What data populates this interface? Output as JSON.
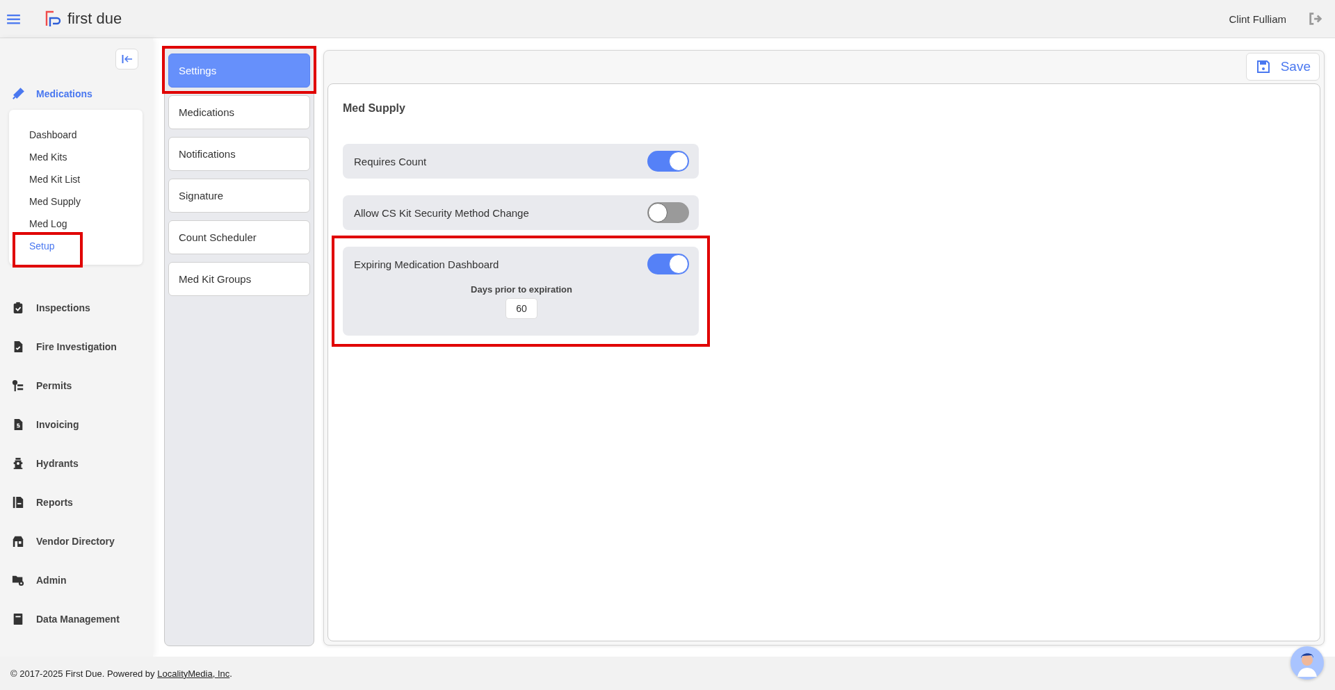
{
  "header": {
    "logo_text": "first due",
    "user_name": "Clint Fulliam"
  },
  "sidebar": {
    "section": {
      "label": "Medications",
      "selected": true
    },
    "submenu": [
      {
        "label": "Dashboard",
        "selected": false,
        "highlighted": false
      },
      {
        "label": "Med Kits",
        "selected": false,
        "highlighted": false
      },
      {
        "label": "Med Kit List",
        "selected": false,
        "highlighted": false
      },
      {
        "label": "Med Supply",
        "selected": false,
        "highlighted": false
      },
      {
        "label": "Med Log",
        "selected": false,
        "highlighted": false
      },
      {
        "label": "Setup",
        "selected": true,
        "highlighted": true
      }
    ],
    "items": [
      {
        "label": "Inspections"
      },
      {
        "label": "Fire Investigation"
      },
      {
        "label": "Permits"
      },
      {
        "label": "Invoicing"
      },
      {
        "label": "Hydrants"
      },
      {
        "label": "Reports"
      },
      {
        "label": "Vendor Directory"
      },
      {
        "label": "Admin"
      },
      {
        "label": "Data Management"
      }
    ]
  },
  "settings_nav": [
    {
      "label": "Settings",
      "selected": true,
      "highlighted": true
    },
    {
      "label": "Medications",
      "selected": false,
      "highlighted": false
    },
    {
      "label": "Notifications",
      "selected": false,
      "highlighted": false
    },
    {
      "label": "Signature",
      "selected": false,
      "highlighted": false
    },
    {
      "label": "Count Scheduler",
      "selected": false,
      "highlighted": false
    },
    {
      "label": "Med Kit Groups",
      "selected": false,
      "highlighted": false
    }
  ],
  "save_button": {
    "label": "Save"
  },
  "panel": {
    "title": "Med Supply",
    "settings": [
      {
        "label": "Requires Count",
        "on": true,
        "highlighted": false
      },
      {
        "label": "Allow CS Kit Security Method Change",
        "on": false,
        "highlighted": false
      },
      {
        "label": "Expiring Medication Dashboard",
        "on": true,
        "highlighted": true,
        "field": {
          "label": "Days prior to expiration",
          "value": "60"
        }
      }
    ]
  },
  "footer": {
    "text": "© 2017-2025 First Due. Powered by ",
    "link": "LocalityMedia, Inc",
    "suffix": "."
  }
}
